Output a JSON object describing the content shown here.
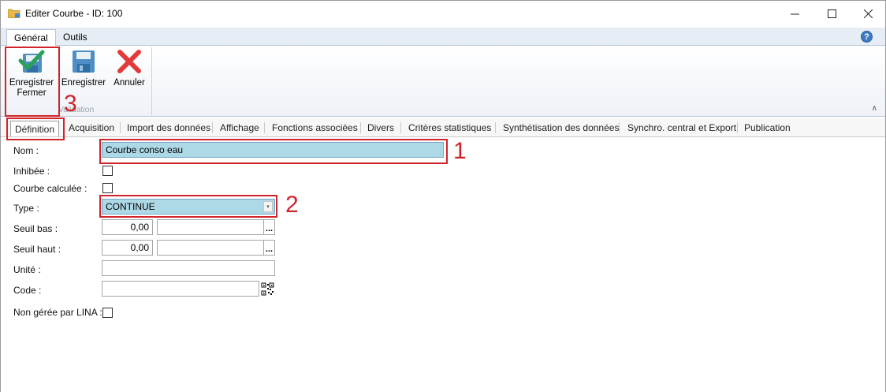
{
  "window": {
    "title": "Editer Courbe - ID: 100",
    "controls": [
      "—",
      "☐",
      "✕"
    ]
  },
  "ribbon": {
    "tabs": [
      "Général",
      "Outils"
    ],
    "help": "?",
    "buttons": {
      "save_close": "Enregistrer\nFermer",
      "save": "Enregistrer",
      "cancel": "Annuler"
    },
    "group_label": "Validation"
  },
  "content_tabs": [
    "Définition",
    "Acquisition",
    "Import des données",
    "Affichage",
    "Fonctions associées",
    "Divers",
    "Critères statistiques",
    "Synthétisation des données",
    "Synchro. central et Export",
    "Publication"
  ],
  "form": {
    "nom": {
      "label": "Nom :",
      "value": "Courbe conso eau"
    },
    "inhibee": {
      "label": "Inhibée :",
      "checked": false
    },
    "calculee": {
      "label": "Courbe calculée :",
      "checked": false
    },
    "type": {
      "label": "Type :",
      "value": "CONTINUE"
    },
    "seuil_bas": {
      "label": "Seuil bas :",
      "value": "0,00",
      "extra": ""
    },
    "seuil_haut": {
      "label": "Seuil haut :",
      "value": "0,00",
      "extra": ""
    },
    "unite": {
      "label": "Unité :",
      "value": ""
    },
    "code": {
      "label": "Code :",
      "value": ""
    },
    "non_geree": {
      "label": "Non gérée par LINA :",
      "checked": false
    }
  },
  "annotations": {
    "one": "1",
    "two": "2",
    "three": "3",
    "color": "#d0242b"
  }
}
